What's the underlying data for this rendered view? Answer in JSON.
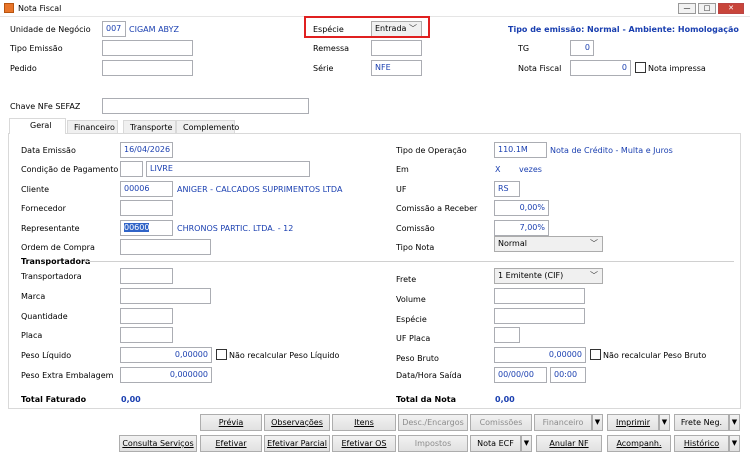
{
  "window": {
    "title": "Nota Fiscal",
    "min_label": "—",
    "max_label": "□",
    "close_label": "✕"
  },
  "header": {
    "unidade_label": "Unidade de Negócio",
    "unidade_code": "007",
    "unidade_name": "CIGAM ABYZ",
    "especie_label": "Espécie",
    "especie_value": "Entrada",
    "tipo_emissao_info": "Tipo de emissão: Normal - Ambiente: Homologação",
    "tipo_emissao_label": "Tipo Emissão",
    "remessa_label": "Remessa",
    "tg_label": "TG",
    "tg_value": "0",
    "pedido_label": "Pedido",
    "serie_label": "Série",
    "serie_value": "NFE",
    "nota_fiscal_label": "Nota Fiscal",
    "nota_fiscal_value": "0",
    "nota_impressa_label": "Nota impressa",
    "chave_label": "Chave NFe SEFAZ"
  },
  "tabs": [
    "Geral",
    "Financeiro",
    "Transporte",
    "Complemento"
  ],
  "geral": {
    "data_emissao_label": "Data Emissão",
    "data_emissao_value": "16/04/2026",
    "condicao_label": "Condição de Pagamento",
    "condicao_value": "LIVRE",
    "cliente_label": "Cliente",
    "cliente_code": "00006",
    "cliente_name": "ANIGER - CALCADOS SUPRIMENTOS LTDA",
    "fornecedor_label": "Fornecedor",
    "representante_label": "Representante",
    "representante_code": "00600",
    "representante_name": "CHRONOS PARTIC. LTDA. - 12",
    "ordem_compra_label": "Ordem de Compra",
    "tipo_operacao_label": "Tipo de Operação",
    "tipo_operacao_code": "110.1M",
    "tipo_operacao_desc": "Nota de Crédito - Multa e Juros",
    "em_label": "Em",
    "em_x": "X",
    "em_vezes": "vezes",
    "uf_label": "UF",
    "uf_value": "RS",
    "comissao_receber_label": "Comissão a Receber",
    "comissao_receber_value": "0,00%",
    "comissao_label": "Comissão",
    "comissao_value": "7,00%",
    "tipo_nota_label": "Tipo Nota",
    "tipo_nota_value": "Normal"
  },
  "transporte": {
    "section_title": "Transportadora",
    "transportadora_label": "Transportadora",
    "marca_label": "Marca",
    "quantidade_label": "Quantidade",
    "placa_label": "Placa",
    "peso_liquido_label": "Peso Líquido",
    "peso_liquido_value": "0,00000",
    "nao_recalcular_liquido": "Não recalcular Peso Líquido",
    "peso_extra_label": "Peso Extra Embalagem",
    "peso_extra_value": "0,000000",
    "frete_label": "Frete",
    "frete_value": "1 Emitente (CIF)",
    "volume_label": "Volume",
    "especie_label": "Espécie",
    "uf_placa_label": "UF Placa",
    "peso_bruto_label": "Peso Bruto",
    "peso_bruto_value": "0,00000",
    "nao_recalcular_bruto": "Não recalcular Peso Bruto",
    "data_hora_saida_label": "Data/Hora Saída",
    "data_saida_value": "00/00/00",
    "hora_saida_value": "00:00"
  },
  "totais": {
    "total_faturado_label": "Total Faturado",
    "total_faturado_value": "0,00",
    "total_nota_label": "Total da Nota",
    "total_nota_value": "0,00"
  },
  "buttons": {
    "previa": "Prévia",
    "observacoes": "Observações",
    "itens": "Itens",
    "desc_encargos": "Desc./Encargos",
    "comissoes": "Comissões",
    "financeiro": "Financeiro",
    "imprimir": "Imprimir",
    "frete_neg": "Frete Neg.",
    "consulta_servicos": "Consulta Serviços",
    "efetivar": "Efetivar",
    "efetivar_parcial": "Efetivar Parcial",
    "efetivar_os": "Efetivar OS",
    "impostos": "Impostos",
    "nota_ecf": "Nota ECF",
    "anular_nf": "Anular NF",
    "acompanh": "Acompanh.",
    "historico": "Histórico"
  },
  "colors": {
    "accent_blue": "#1a3fb0",
    "highlight_red": "#e02020",
    "window_icon": "#e8752a"
  }
}
